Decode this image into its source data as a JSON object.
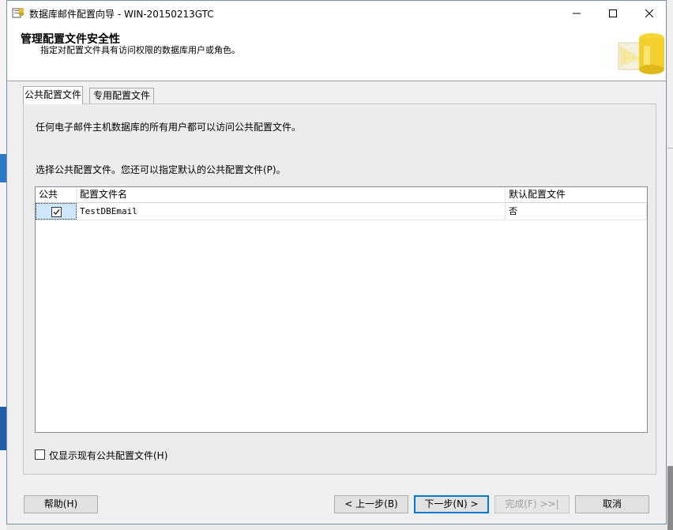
{
  "window": {
    "title": "数据库邮件配置向导 - WIN-20150213GTC",
    "minimize_glyph": "─",
    "maximize_glyph": "☐",
    "close_glyph": "✕"
  },
  "header": {
    "title": "管理配置文件安全性",
    "subtitle": "指定对配置文件具有访问权限的数据库用户或角色。"
  },
  "tabs": [
    {
      "label": "公共配置文件",
      "active": true
    },
    {
      "label": "专用配置文件",
      "active": false
    }
  ],
  "panel": {
    "description": "任何电子邮件主机数据库的所有用户都可以访问公共配置文件。",
    "instruction": "选择公共配置文件。您还可以指定默认的公共配置文件(P)。",
    "grid": {
      "columns": [
        "公共",
        "配置文件名",
        "默认配置文件"
      ],
      "rows": [
        {
          "public": true,
          "profile_name": "TestDBEmail",
          "default": "否"
        }
      ]
    },
    "only_public_label": "仅显示现有公共配置文件(H)",
    "only_public_checked": false
  },
  "buttons": {
    "help": "帮助(H)",
    "back": "< 上一步(B)",
    "next": "下一步(N) >",
    "finish": "完成(F) >>|",
    "cancel": "取消"
  },
  "colors": {
    "accent": "#0078d7",
    "selection": "#cde6fb"
  }
}
